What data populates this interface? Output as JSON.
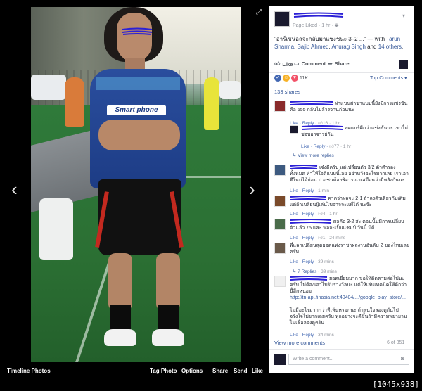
{
  "viewer": {
    "album_label": "Timeline Photos",
    "prev_icon": "chevron-left-icon",
    "next_icon": "chevron-right-icon",
    "expand_icon": "expand-icon",
    "actions": {
      "tag": "Tag Photo",
      "options": "Options",
      "share": "Share",
      "send": "Send",
      "like": "Like"
    },
    "photo_sponsor_text": "Smart phone"
  },
  "post": {
    "meta": "Page Liked · 1 hr · ",
    "text_quote": "\"อาร์เซน่อลจะกลับมาแซงชนะ 3–2 ...\"",
    "text_with": " — with ",
    "tag_1": "Tarun Sharma",
    "tag_2": "Sajib Ahmed",
    "tag_3": "Anurag Singh",
    "and_text": " and ",
    "others": "14 others",
    "like_label": "Like",
    "comment_label": "Comment",
    "share_label": "Share",
    "reaction_count": "11K",
    "top_comments": "Top Comments ▾",
    "shares": "133 shares"
  },
  "comments": [
    {
      "name": "",
      "text": "ผ่าแขนผ่าขาแบบนี้ยังมีการแข่งขันคือ 555 กลับไปล้างจานก่อนนะ",
      "meta_reply": "Like · Reply · ",
      "likes": "16",
      "time": " · 1 hr"
    },
    {
      "name": "",
      "text": "ลดแกร์ดีกว่าแข่งขันนะ เขาไม่ชอบอาจารย์กัน",
      "meta_reply": "Like · Reply · ",
      "likes": "77",
      "time": " · 1 hr",
      "view_more": "View more replies"
    },
    {
      "name": "",
      "text": "เจ๋งดีครับ แต่เปลี่ยนตัว 3/2 ตัวสำรองทั้งหมด ทำให้ใจดีแบบนี้เลย อย่าหวังอะไรมากเลย เราเอาทีใหม่ได้ก่อน ปวงชนต้องพิจารณาเสมือนว่ามีพลังกันนะ",
      "meta_reply": "Like · Reply · ",
      "likes": "",
      "time": "1 min"
    },
    {
      "name": "",
      "text": "คาดว่าผลจะ 2-1 ถ้าลงตัวเดียวกับเดิม แต่ถ้าเปลี่ยนผู้เล่นไปอาจจะแพ้ได้ นะจ๊ะ",
      "meta_reply": "Like · Reply · ",
      "likes": "4",
      "time": " · 1 hr"
    },
    {
      "name": "",
      "text": "ผลคือ 3-2 สะ ตอนนั้นมีการเปลี่ยนตัวแล้ว 75 และ พอจะเป็นแชมป์ วันนี้ มีดี",
      "meta_reply": "Like · Reply · ",
      "likes": "1",
      "time": " · 24 mins"
    },
    {
      "name": "",
      "text": "พี่แลกเปลี่ยนสุดยอดแห่งราชาผลงานอันดับ 2 ของไทยเลยครับ",
      "meta_reply": "Like · Reply · ",
      "likes": "",
      "time": "39 mins",
      "replies": "7 Replies",
      "replies_time": " · 39 mins"
    },
    {
      "name": "",
      "text": "ยอดเยี่ยมมาก ขอให้ติดตามต่อไปนะครับ ไม่ต้องเอาไปรับรางวัลนะ แต่ให้เล่นเทคนิคให้ดีกว่านี้อีกหน่อย",
      "link": "http://tn-api.finasia.net:40404/.../google_play_store/...",
      "text2": "ไม่มีอะไรมากกว่าที่เห็นหรอกนะ ถ้าสนใจลองดูกันไป จริงใจไม่ยากเลยครับ ทุกอย่างจะดีขึ้นถ้ามีความพยายาม ไม่เชื่อลองดูครับ",
      "meta_reply": "Like · Reply · ",
      "likes": "",
      "time": "34 mins"
    }
  ],
  "footer": {
    "view_more": "View more comments",
    "count": "6 of 351",
    "input_placeholder": "Write a comment...",
    "camera_icon": "camera-icon"
  },
  "watermark": "[1045x938] https://upic.me/",
  "colors": {
    "link": "#365899",
    "scribble": "#2b20d6",
    "jersey": "#1d3c85",
    "field": "#2f7a3a"
  }
}
